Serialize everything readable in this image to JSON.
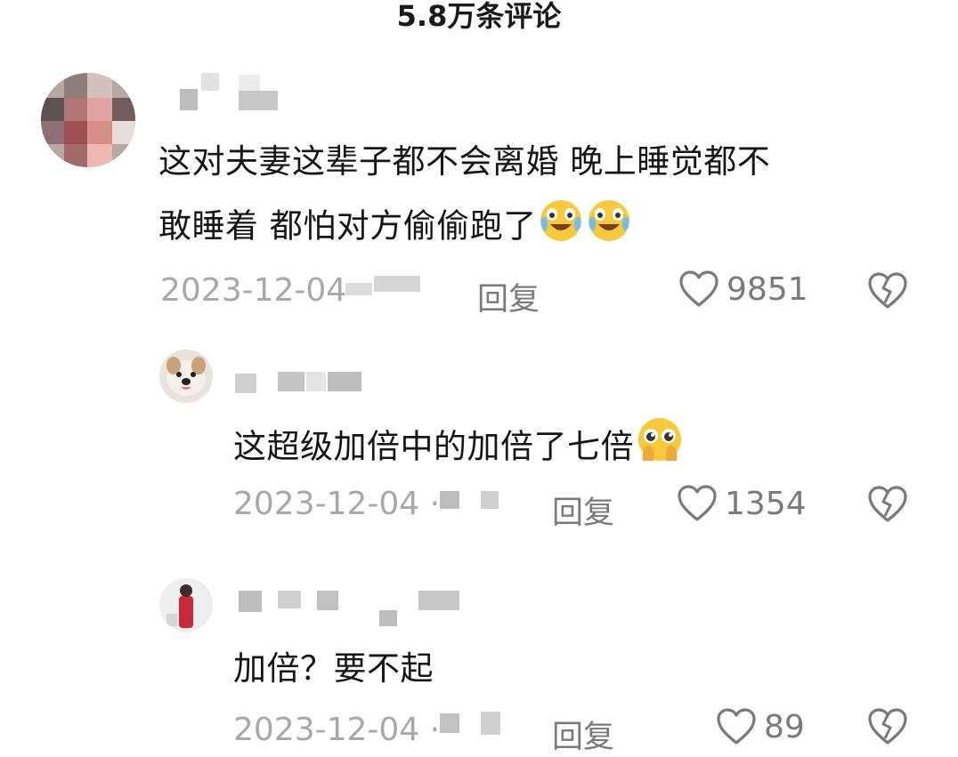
{
  "header": {
    "title": "5.8万条评论"
  },
  "comments": [
    {
      "text_line1": "这对夫妻这辈子都不会离婚 晚上睡觉都不",
      "text_line2": "敢睡着 都怕对方偷偷跑了",
      "emojis": [
        "crying-laugh-icon",
        "crying-laugh-icon"
      ],
      "date": "2023-12-04",
      "reply_label": "回复",
      "likes": "9851"
    },
    {
      "text": "这超级加倍中的加倍了七倍",
      "emojis": [
        "pleading-face-icon"
      ],
      "date": "2023-12-04 ·",
      "reply_label": "回复",
      "likes": "1354"
    },
    {
      "text": "加倍？要不起",
      "date": "2023-12-04 ·",
      "reply_label": "回复",
      "likes": "89"
    }
  ],
  "colors": {
    "text": "#161616",
    "meta": "#a8a8a8",
    "icon": "#7a7a7a"
  }
}
